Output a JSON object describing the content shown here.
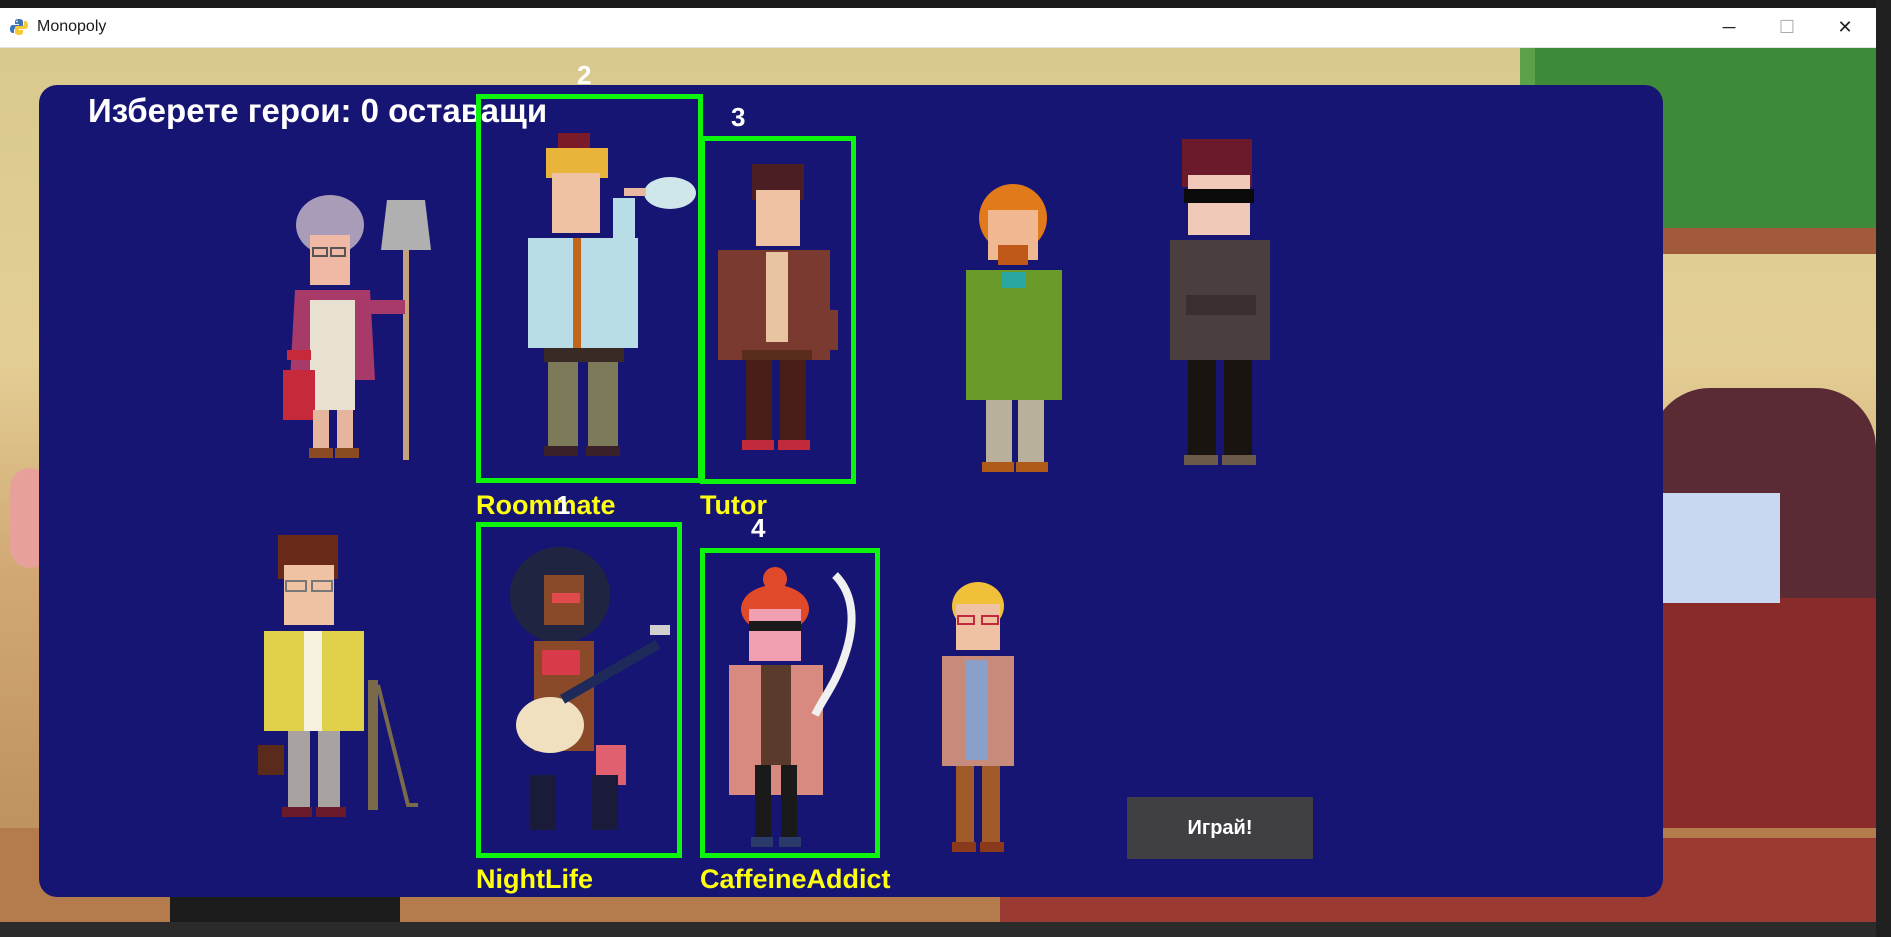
{
  "window": {
    "title": "Monopoly",
    "minimize_glyph": "─",
    "maximize_glyph": "☐",
    "close_glyph": "✕"
  },
  "heading": "Изберете герои: 0 оставащи",
  "play_button": "Играй!",
  "heroes": [
    {
      "id": "cleaner",
      "name": "",
      "selected": false,
      "order": ""
    },
    {
      "id": "roommate",
      "name": "Roommate",
      "selected": true,
      "order": "2"
    },
    {
      "id": "tutor",
      "name": "Tutor",
      "selected": true,
      "order": "3"
    },
    {
      "id": "green-coat",
      "name": "",
      "selected": false,
      "order": ""
    },
    {
      "id": "sunglasses",
      "name": "",
      "selected": false,
      "order": ""
    },
    {
      "id": "yellow-jacket",
      "name": "",
      "selected": false,
      "order": ""
    },
    {
      "id": "nightlife",
      "name": "NightLife",
      "selected": true,
      "order": "1"
    },
    {
      "id": "caffeine-addict",
      "name": "CaffeineAddict",
      "selected": true,
      "order": "4"
    },
    {
      "id": "blonde-glasses",
      "name": "",
      "selected": false,
      "order": ""
    }
  ],
  "colors": {
    "panel": "#171574",
    "selection_border": "#0df50d",
    "hero_name": "#ffff10",
    "button": "#3f3f44"
  },
  "icons": {
    "app": "python-snake-icon"
  }
}
